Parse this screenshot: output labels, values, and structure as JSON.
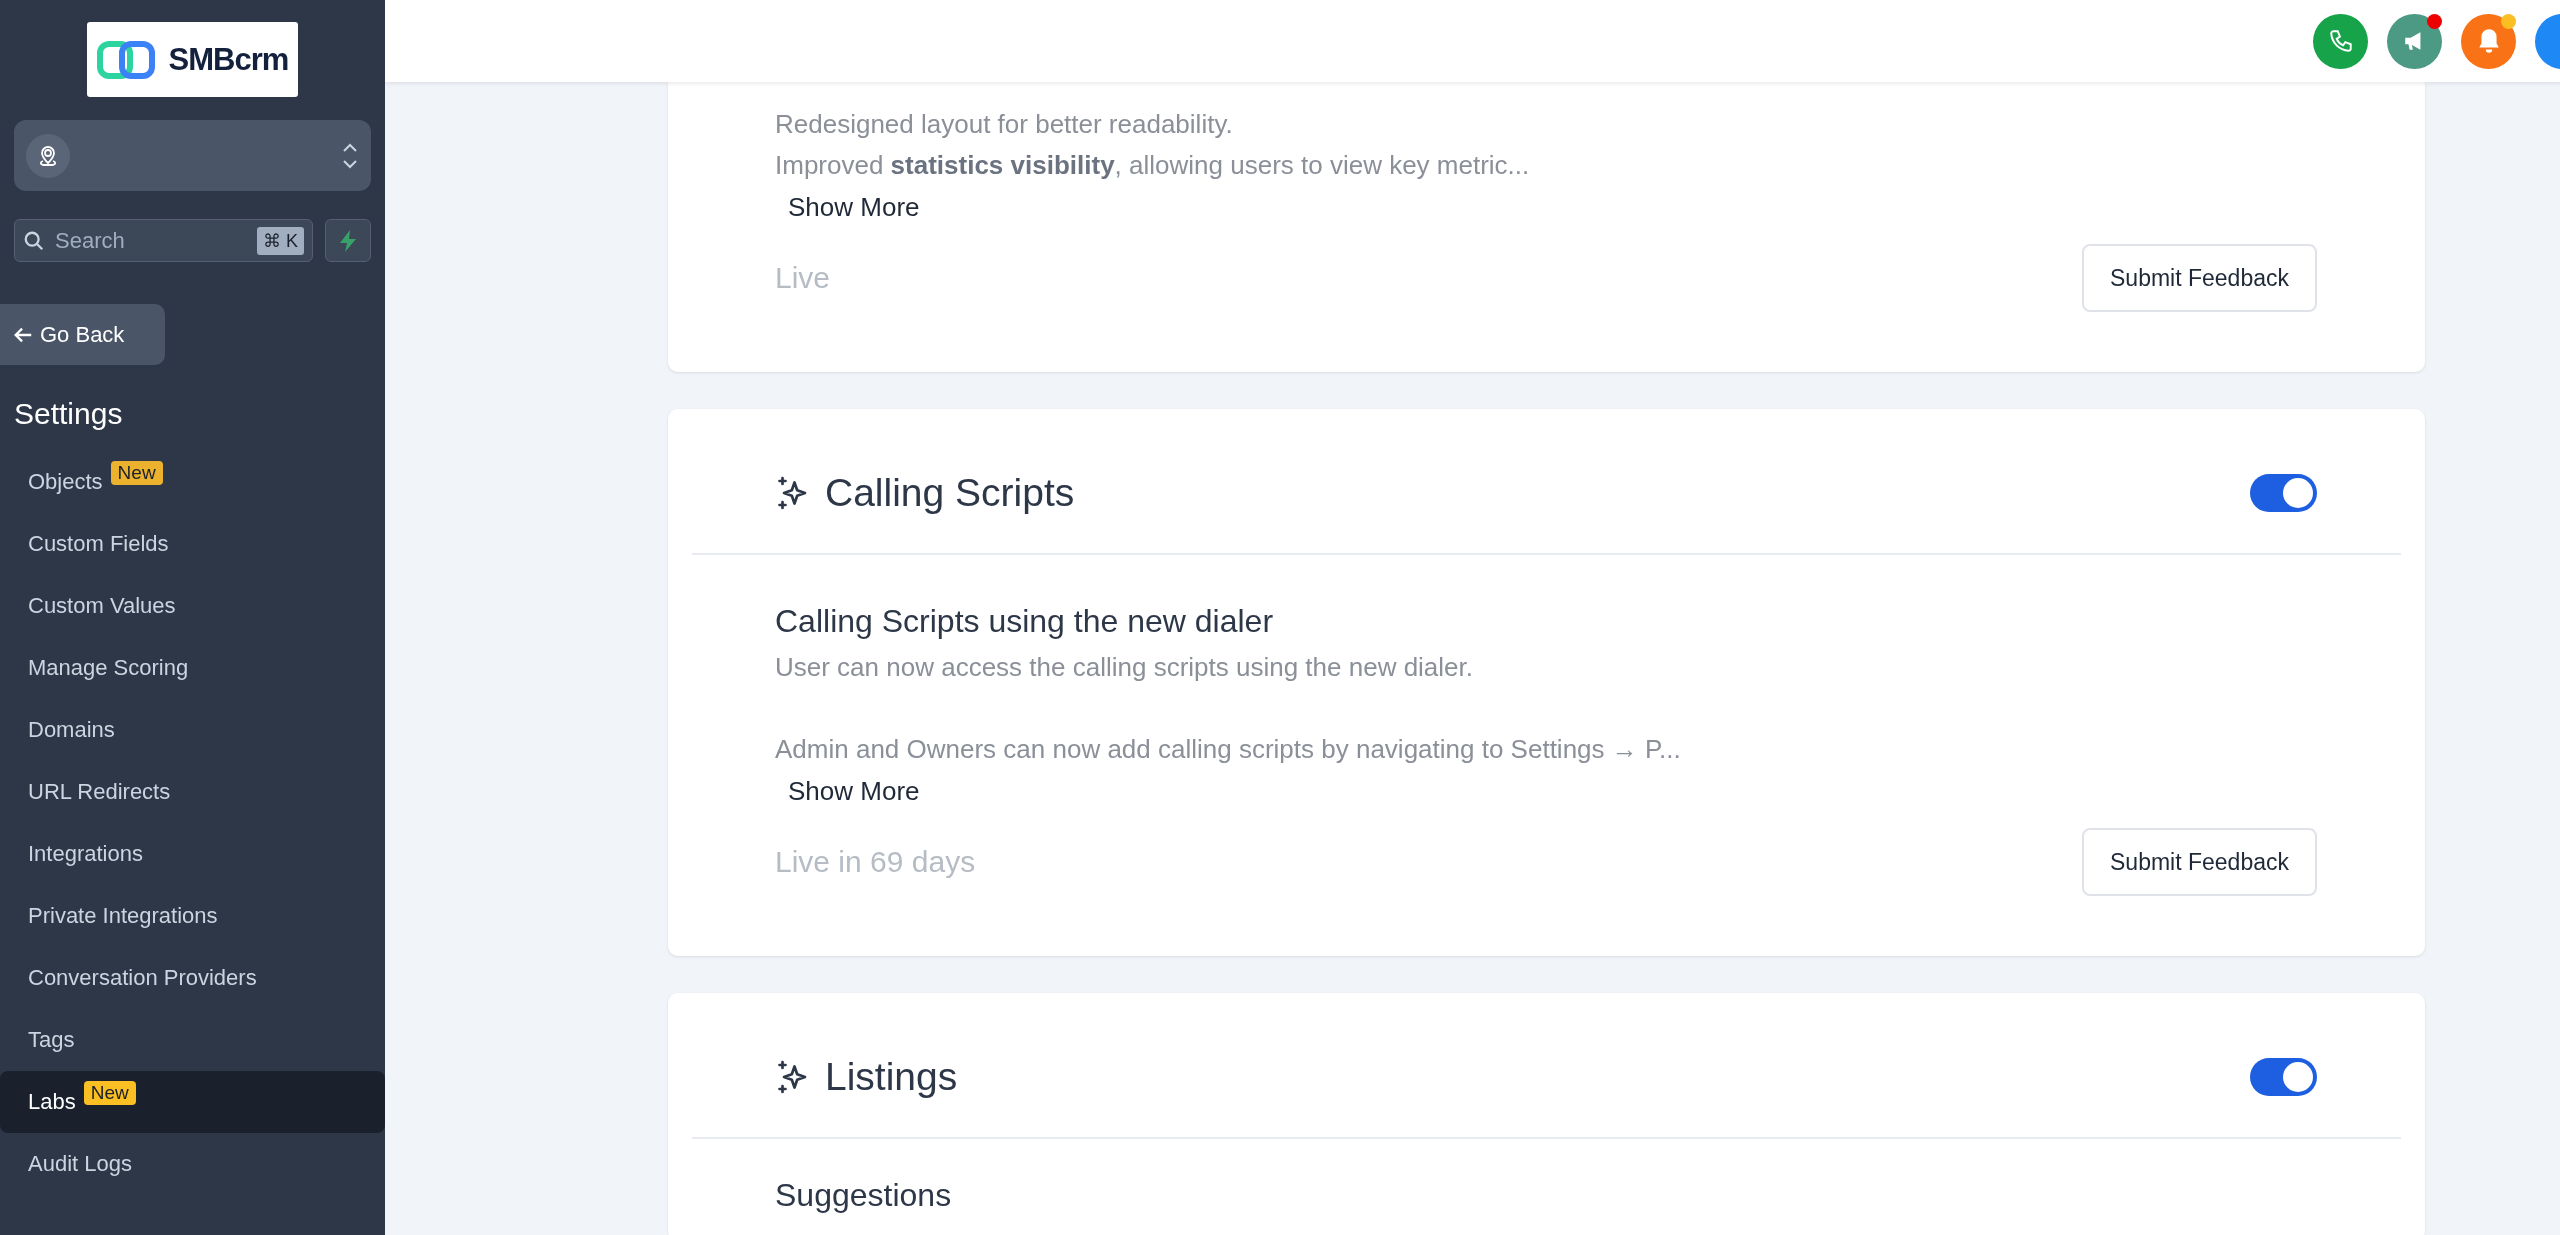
{
  "sidebar": {
    "logo": {
      "text": "SMBcrm"
    },
    "search": {
      "placeholder": "Search",
      "shortcut": "⌘ K"
    },
    "back_button": "Go Back",
    "heading": "Settings",
    "items": [
      {
        "label": "Objects",
        "badge": "New",
        "selected": false
      },
      {
        "label": "Custom Fields",
        "selected": false
      },
      {
        "label": "Custom Values",
        "selected": false
      },
      {
        "label": "Manage Scoring",
        "selected": false
      },
      {
        "label": "Domains",
        "selected": false
      },
      {
        "label": "URL Redirects",
        "selected": false
      },
      {
        "label": "Integrations",
        "selected": false
      },
      {
        "label": "Private Integrations",
        "selected": false
      },
      {
        "label": "Conversation Providers",
        "selected": false
      },
      {
        "label": "Tags",
        "selected": false
      },
      {
        "label": "Labs",
        "badge": "New",
        "selected": true
      },
      {
        "label": "Audit Logs",
        "selected": false
      }
    ]
  },
  "cards": [
    {
      "description": [
        [
          "Redesigned layout for better readability.",
          "Improved **statistics visibility**, allowing users to view key metric..."
        ]
      ],
      "show_more": "Show More",
      "status": "Live",
      "feedback_button": "Submit Feedback"
    },
    {
      "title": "Calling Scripts",
      "enabled": true,
      "subtitle": "Calling Scripts using the new dialer",
      "description": [
        [
          "User can now access the calling scripts using the new dialer."
        ],
        [
          "Admin and Owners can now add calling scripts by navigating to Settings → P..."
        ]
      ],
      "show_more": "Show More",
      "status": "Live in 69 days",
      "feedback_button": "Submit Feedback"
    },
    {
      "title": "Listings",
      "enabled": true,
      "subtitle": "Suggestions"
    }
  ]
}
